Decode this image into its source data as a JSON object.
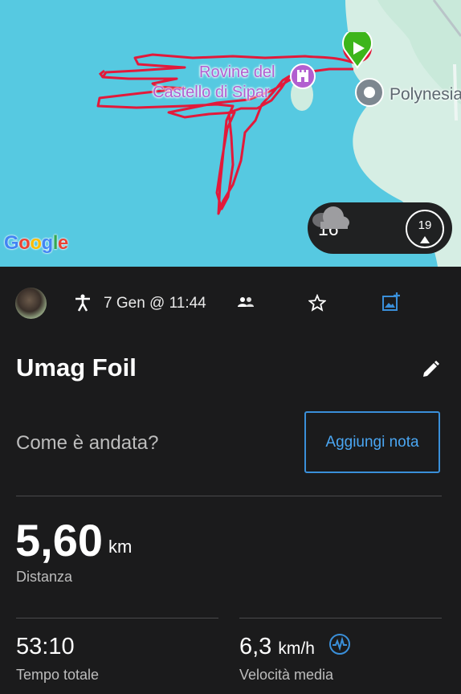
{
  "map": {
    "poi_label_line1": "Rovine del",
    "poi_label_line2": "Castello di Sipar",
    "place_label": "Polynesia",
    "attribution": "Google",
    "colors": {
      "water": "#56c9e1",
      "land": "#d4eee3",
      "track": "#e3193a",
      "poi": "#b25fd0",
      "start": "#3db51b"
    },
    "icons": [
      "castle-icon",
      "location-pin-icon",
      "start-flag-icon"
    ]
  },
  "weather": {
    "temperature": "16°",
    "icon": "cloud-icon",
    "wind_speed": "19"
  },
  "activity": {
    "date": "7 Gen @ 11:44",
    "title": "Umag Foil",
    "note_prompt": "Come è andata?",
    "note_button": "Aggiungi nota"
  },
  "stats": {
    "distance_value": "5,60",
    "distance_unit": "km",
    "distance_label": "Distanza",
    "time_value": "53:10",
    "time_label": "Tempo totale",
    "speed_value": "6,3",
    "speed_unit": "km/h",
    "speed_label": "Velocità media"
  },
  "colors": {
    "background": "#1b1b1c",
    "accent": "#3a8fd9"
  }
}
